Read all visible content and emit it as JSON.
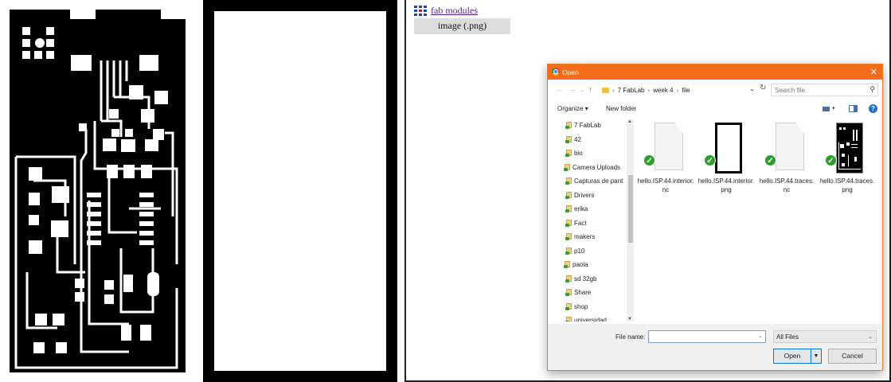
{
  "app": {
    "link_label": "fab modules",
    "format_button_label": "image (.png)"
  },
  "dialog": {
    "title": "Open",
    "breadcrumbs": [
      "7 FabLab",
      "week 4",
      "file"
    ],
    "search_placeholder": "Search file",
    "toolbar": {
      "organize_label": "Organize",
      "new_folder_label": "New folder"
    },
    "nav_items": [
      "7 FabLab",
      "42",
      "bio",
      "Camera Uploads",
      "Capturas de pant",
      "Drivers",
      "erika",
      "Fact",
      "makers",
      "p10",
      "paola",
      "sd 32gb",
      "Share",
      "shop",
      "universidad"
    ],
    "files": [
      {
        "name": "hello.ISP.44.interior.nc",
        "icon": "document-icon"
      },
      {
        "name": "hello.ISP.44.interior.png",
        "icon": "image-thumbnail"
      },
      {
        "name": "hello.ISP.44.traces.nc",
        "icon": "document-icon"
      },
      {
        "name": "hello.ISP.44.traces.png",
        "icon": "image-thumbnail"
      }
    ],
    "file_name_label": "File name:",
    "file_name_value": "",
    "file_type": "All Files",
    "open_label": "Open",
    "cancel_label": "Cancel"
  },
  "colors": {
    "title_bar": "#f36b1b",
    "link": "#551a8b",
    "check": "#2e9d2e",
    "primary_border": "#0078d7"
  }
}
